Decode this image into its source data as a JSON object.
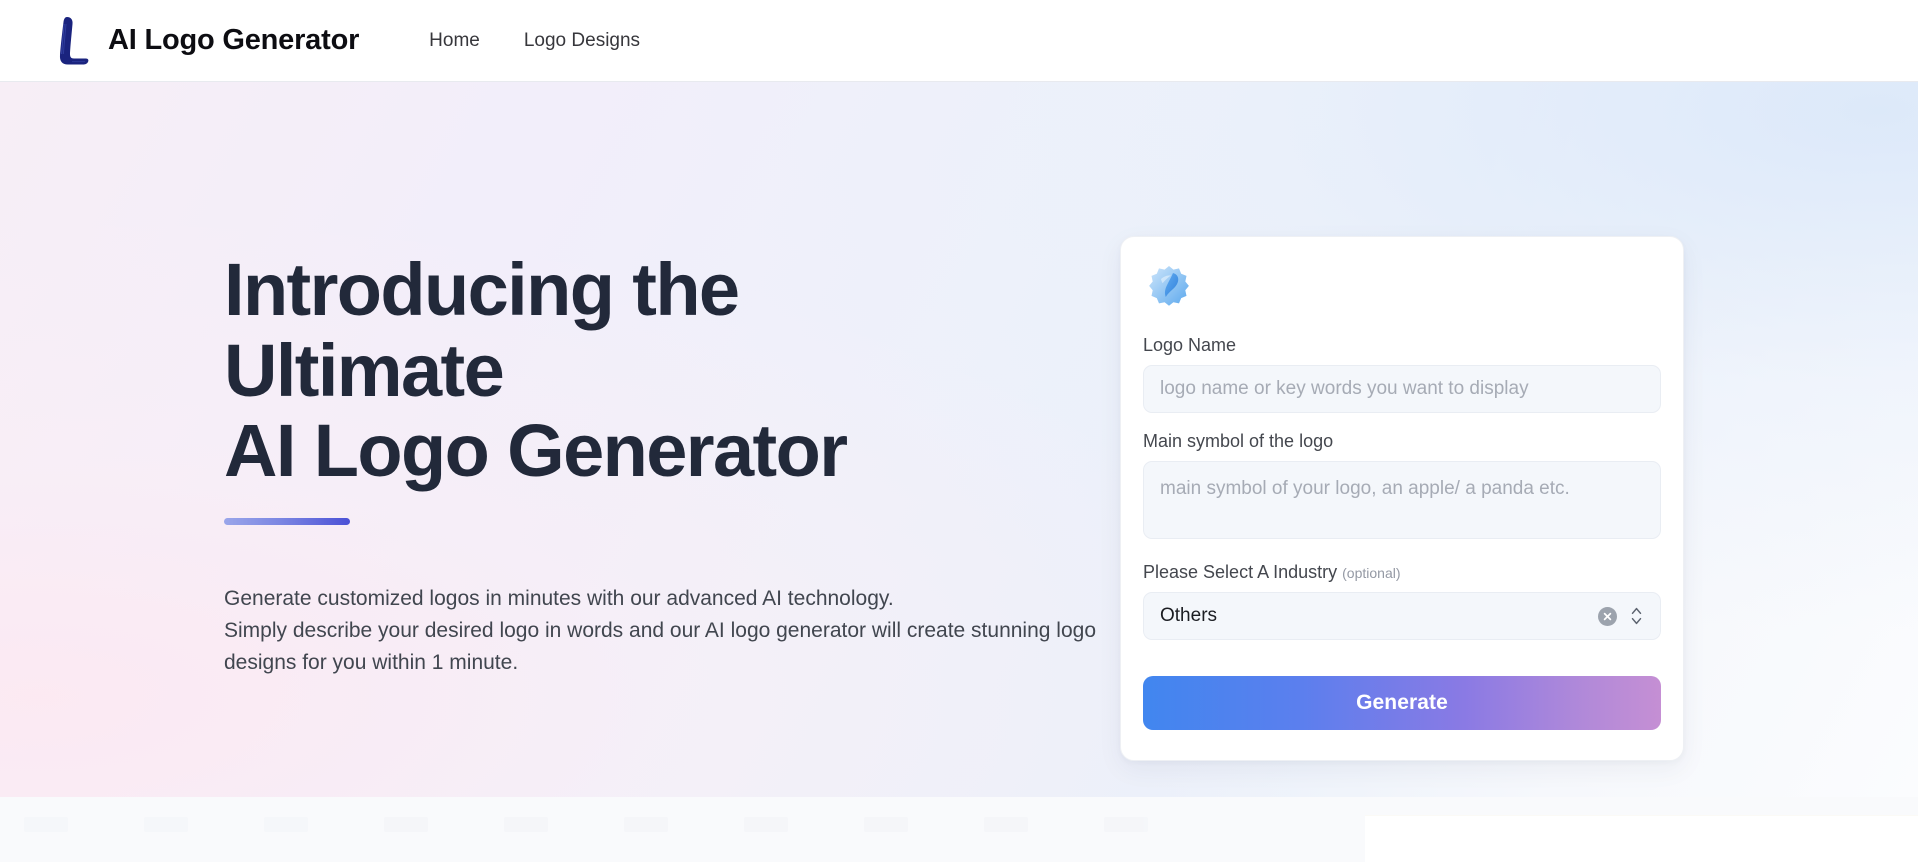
{
  "header": {
    "brand_name": "AI Logo Generator",
    "brand_icon": "stylized-l-logo-icon",
    "nav": [
      {
        "label": "Home",
        "name": "nav-link-home"
      },
      {
        "label": "Logo Designs",
        "name": "nav-link-logo-designs"
      }
    ]
  },
  "hero": {
    "headline_lines": [
      "Introducing the",
      "Ultimate",
      "AI Logo Generator"
    ],
    "copy_lines": [
      "Generate customized logos in minutes with our advanced AI technology.",
      "Simply describe your desired logo in words and our AI logo generator will create stunning logo",
      "designs for you within 1 minute."
    ],
    "accent_rule": true
  },
  "form": {
    "card_icon": "blue-blob-logo-icon",
    "logo_name": {
      "label": "Logo Name",
      "placeholder": "logo name or key words you want to display",
      "value": ""
    },
    "main_symbol": {
      "label": "Main symbol of the logo",
      "placeholder": "main symbol of your logo, an apple/ a panda etc.",
      "value": ""
    },
    "industry": {
      "label": "Please Select A Industry",
      "optional_note": "(optional)",
      "selected": "Others",
      "clear_icon": "clear-circle-x-icon",
      "stepper_icon": "chevron-up-down-icon"
    },
    "submit_label": "Generate"
  },
  "colors": {
    "brand_navy": "#1a237e",
    "headline": "#22293a",
    "accent_rule_from": "#9aa6ea",
    "accent_rule_to": "#4b51d6",
    "button_gradient_from": "#4186ef",
    "button_gradient_to": "#c58fd4",
    "input_fill": "#f4f7fb",
    "card_bg": "#ffffff"
  }
}
